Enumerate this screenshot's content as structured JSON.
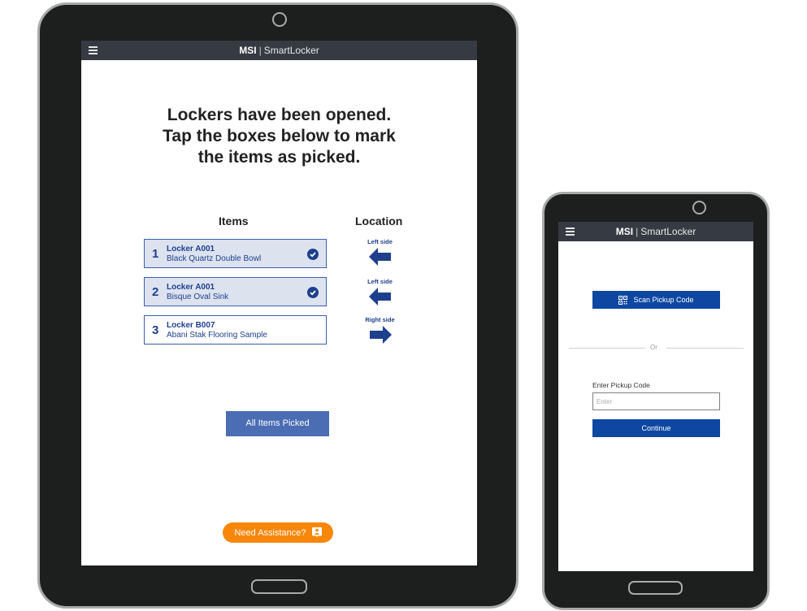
{
  "app": {
    "brand_bold": "MSI",
    "brand_separator": "|",
    "brand_product": "SmartLocker"
  },
  "tablet": {
    "headline_lines": [
      "Lockers have been opened.",
      "Tap the boxes below to mark",
      "the items as picked."
    ],
    "columns": {
      "items": "Items",
      "location": "Location"
    },
    "items": [
      {
        "number": "1",
        "locker": "Locker A001",
        "description": "Black Quartz Double Bowl",
        "picked": true,
        "side": "Left side",
        "direction": "left"
      },
      {
        "number": "2",
        "locker": "Locker A001",
        "description": "Bisque Oval Sink",
        "picked": true,
        "side": "Left side",
        "direction": "left"
      },
      {
        "number": "3",
        "locker": "Locker B007",
        "description": "Abani Stak Flooring Sample",
        "picked": false,
        "side": "Right side",
        "direction": "right"
      }
    ],
    "all_picked_label": "All Items Picked",
    "assist_label": "Need Assistance?"
  },
  "phone": {
    "scan_label": "Scan Pickup Code",
    "or_label": "Or",
    "code_label": "Enter Pickup Code",
    "code_value": "",
    "code_placeholder": "Enter",
    "continue_label": "Continue"
  },
  "colors": {
    "appbar": "#363a42",
    "primary_blue": "#0d47a1",
    "button_blue": "#4a6db3",
    "item_text": "#1f3f8e",
    "picked_bg": "#dce3ef",
    "assist_orange": "#f7870b",
    "device_body": "#1d1e1e"
  }
}
